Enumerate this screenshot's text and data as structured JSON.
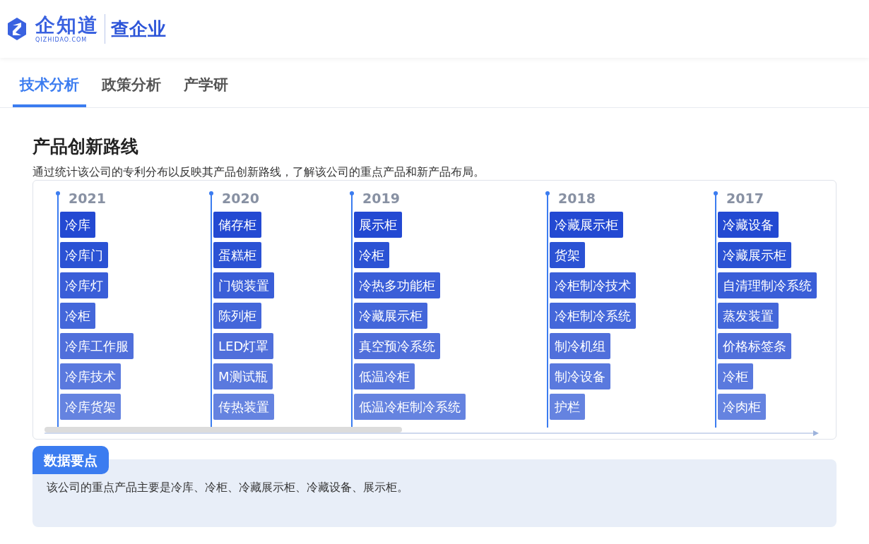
{
  "header": {
    "logo_text": "企知道",
    "logo_subtext": "QIZHIDAO.COM",
    "product": "查企业"
  },
  "tabs": [
    {
      "label": "技术分析",
      "selected": true
    },
    {
      "label": "政策分析",
      "selected": false
    },
    {
      "label": "产学研",
      "selected": false
    }
  ],
  "section": {
    "title": "产品创新路线",
    "description": "通过统计该公司的专利分布以反映其产品创新路线，了解该公司的重点产品和新产品布局。"
  },
  "timeline": [
    {
      "year": "2021",
      "tags": [
        "冷库",
        "冷库门",
        "冷库灯",
        "冷柜",
        "冷库工作服",
        "冷库技术",
        "冷库货架"
      ]
    },
    {
      "year": "2020",
      "tags": [
        "储存柜",
        "蛋糕柜",
        "门锁装置",
        "陈列柜",
        "LED灯罩",
        "M测试瓶",
        "传热装置"
      ]
    },
    {
      "year": "2019",
      "tags": [
        "展示柜",
        "冷柜",
        "冷热多功能柜",
        "冷藏展示柜",
        "真空预冷系统",
        "低温冷柜",
        "低温冷柜制冷系统"
      ]
    },
    {
      "year": "2018",
      "tags": [
        "冷藏展示柜",
        "货架",
        "冷柜制冷技术",
        "冷柜制冷系统",
        "制冷机组",
        "制冷设备",
        "护栏"
      ]
    },
    {
      "year": "2017",
      "tags": [
        "冷藏设备",
        "冷藏展示柜",
        "自清理制冷系统",
        "蒸发装置",
        "价格标签条",
        "冷柜",
        "冷肉柜"
      ]
    }
  ],
  "key_points": {
    "label": "数据要点",
    "text": "该公司的重点产品主要是冷库、冷柜、冷藏展示柜、冷藏设备、展示柜。"
  }
}
